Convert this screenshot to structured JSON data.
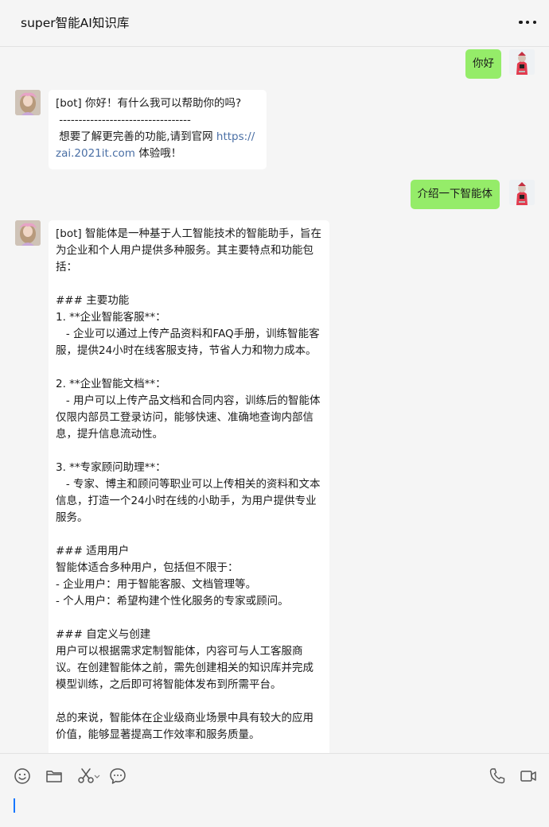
{
  "header": {
    "title": "super智能AI知识库",
    "more_icon": "more-dots-icon"
  },
  "messages": [
    {
      "role": "user",
      "text": "你好"
    },
    {
      "role": "bot",
      "line1": "[bot] 你好！有什么我可以帮助你的吗?",
      "line2": " ----------------------------------",
      "line3_before_link": " 想要了解更完善的功能,请到官网 ",
      "link": "https://zai.2021it.com",
      "line3_after_link": " 体验哦！"
    },
    {
      "role": "user",
      "text": "介绍一下智能体"
    },
    {
      "role": "bot",
      "text": "[bot] 智能体是一种基于人工智能技术的智能助手，旨在为企业和个人用户提供多种服务。其主要特点和功能包括：\n\n### 主要功能\n1. **企业智能客服**：\n   - 企业可以通过上传产品资料和FAQ手册，训练智能客服，提供24小时在线客服支持，节省人力和物力成本。\n\n2. **企业智能文档**：\n   - 用户可以上传产品文档和合同内容，训练后的智能体仅限内部员工登录访问，能够快速、准确地查询内部信息，提升信息流动性。\n\n3. **专家顾问助理**：\n   - 专家、博主和顾问等职业可以上传相关的资料和文本信息，打造一个24小时在线的小助手，为用户提供专业服务。\n\n### 适用用户\n智能体适合多种用户，包括但不限于：\n- 企业用户：用于智能客服、文档管理等。\n- 个人用户：希望构建个性化服务的专家或顾问。\n\n### 自定义与创建\n用户可以根据需求定制智能体，内容可与人工客服商议。在创建智能体之前，需先创建相关的知识库并完成模型训练，之后即可将智能体发布到所需平台。\n\n总的来说，智能体在企业级商业场景中具有较大的应用价值，能够显著提高工作效率和服务质量。"
    }
  ],
  "toolbar": {
    "left_icons": [
      "emoji-icon",
      "folder-icon",
      "scissors-icon",
      "chevron-down-icon",
      "chat-bubble-icon"
    ],
    "right_icons": [
      "phone-icon",
      "video-camera-icon"
    ]
  },
  "colors": {
    "user_bubble": "#95ec69",
    "bot_bubble": "#ffffff",
    "link": "#4a6fa5",
    "caret": "#1677ff"
  }
}
